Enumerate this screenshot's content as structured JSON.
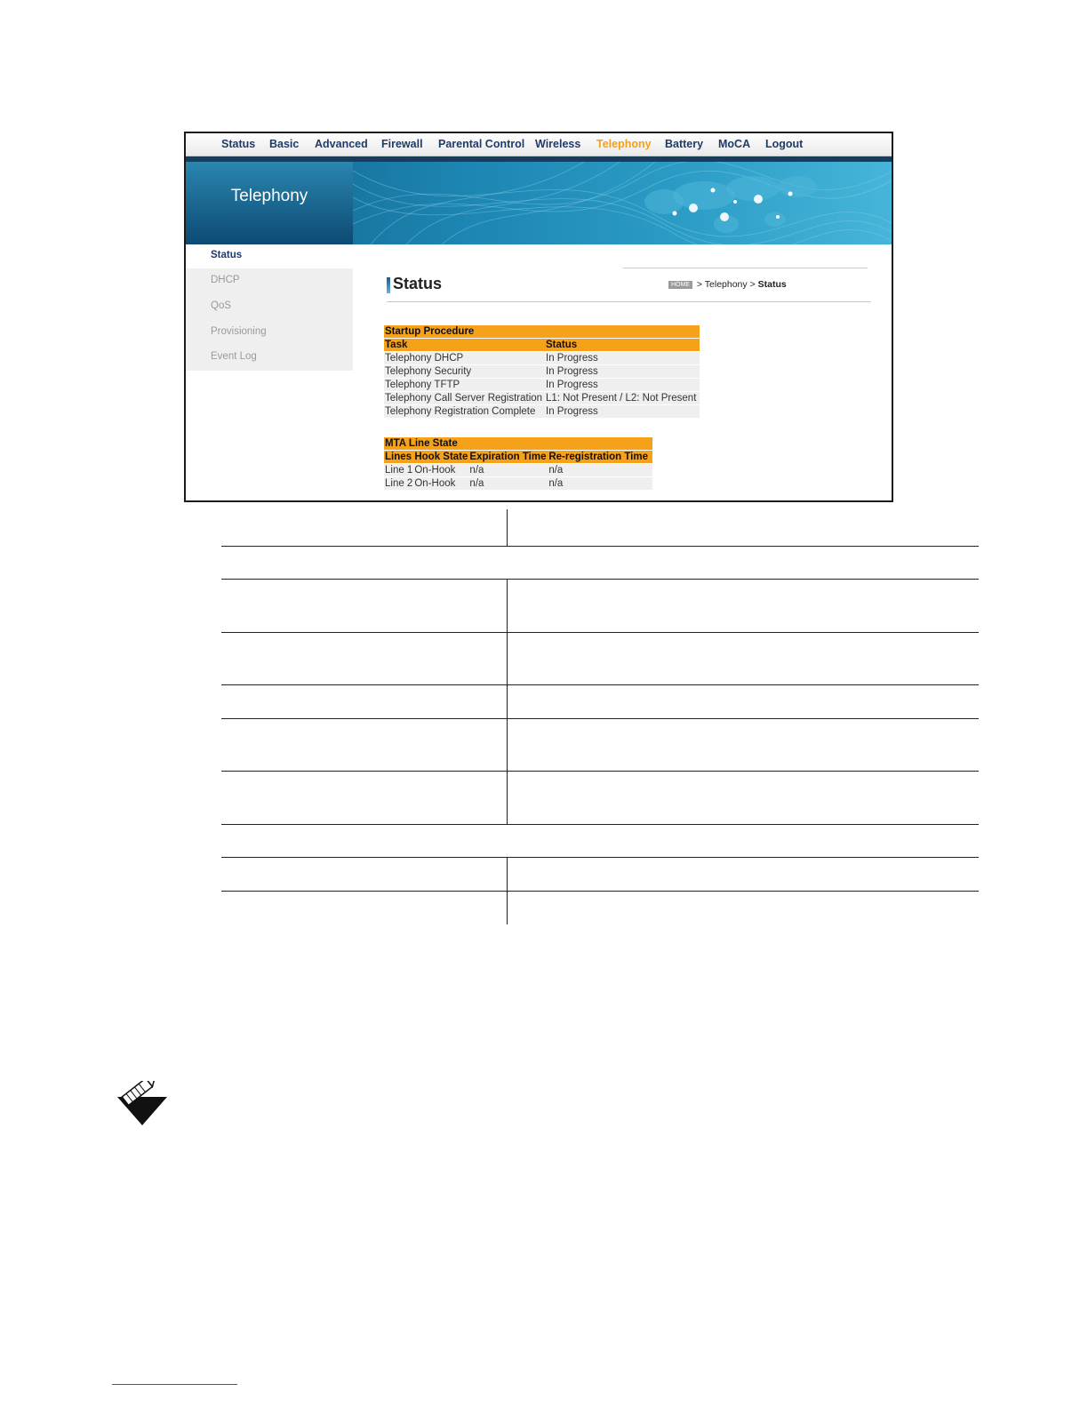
{
  "top_nav": {
    "items": [
      "Status",
      "Basic",
      "Advanced",
      "Firewall",
      "Parental Control",
      "Wireless",
      "Telephony",
      "Battery",
      "MoCA",
      "Logout"
    ],
    "active": "Telephony"
  },
  "banner": {
    "title": "Telephony"
  },
  "sidebar": {
    "items": [
      "Status",
      "DHCP",
      "QoS",
      "Provisioning",
      "Event Log"
    ],
    "active": "Status"
  },
  "content": {
    "title": "Status",
    "breadcrumb": {
      "home": "HOME",
      "sep1": " > ",
      "section": "Telephony",
      "sep2": " > ",
      "current": "Status"
    }
  },
  "startup_procedure": {
    "title": "Startup Procedure",
    "columns": [
      "Task",
      "Status"
    ],
    "rows": [
      [
        "Telephony DHCP",
        "In Progress"
      ],
      [
        "Telephony Security",
        "In Progress"
      ],
      [
        "Telephony TFTP",
        "In Progress"
      ],
      [
        "Telephony Call Server Registration",
        "L1: Not Present / L2: Not Present"
      ],
      [
        "Telephony Registration Complete",
        "In Progress"
      ]
    ]
  },
  "mta_line_state": {
    "title": "MTA Line State",
    "columns": [
      "Lines",
      "Hook State",
      "Expiration Time",
      "Re-registration Time"
    ],
    "rows": [
      [
        "Line 1",
        "On-Hook",
        "n/a",
        "n/a"
      ],
      [
        "Line 2",
        "On-Hook",
        "n/a",
        "n/a"
      ]
    ]
  },
  "colors": {
    "nav_text": "#1f3b6b",
    "nav_active": "#f3a01a",
    "table_header": "#f6a11a",
    "banner_dark": "#0c4a73"
  },
  "icons": {
    "note": "note-pencil-icon"
  }
}
